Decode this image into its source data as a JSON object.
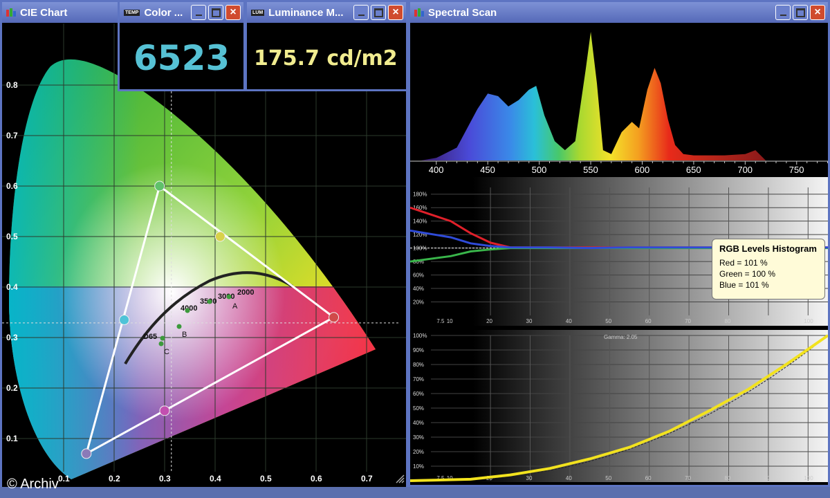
{
  "cie_window": {
    "title": "CIE Chart"
  },
  "color_window": {
    "title": "Color ...",
    "value": "6523"
  },
  "luminance_window": {
    "title": "Luminance M...",
    "value": "175.7 cd/m2"
  },
  "spectral_window": {
    "title": "Spectral Scan"
  },
  "copyright": "© Archiv",
  "icons": {
    "temp_icon": "TEMP",
    "lum_icon": "LUM"
  },
  "cie_chart": {
    "x_ticks": [
      "0.1",
      "0.2",
      "0.3",
      "0.4",
      "0.5",
      "0.6",
      "0.7"
    ],
    "y_ticks": [
      "0.1",
      "0.2",
      "0.3",
      "0.4",
      "0.5",
      "0.6",
      "0.7",
      "0.8"
    ],
    "cct_labels": [
      "2000",
      "3000",
      "3500",
      "4000",
      "D65"
    ],
    "illuminant_labels": [
      "A",
      "B",
      "C"
    ],
    "triangle_points": [
      {
        "x": 0.29,
        "y": 0.6
      },
      {
        "x": 0.635,
        "y": 0.34
      },
      {
        "x": 0.145,
        "y": 0.07
      }
    ],
    "secondary_points": [
      {
        "x": 0.41,
        "y": 0.5
      },
      {
        "x": 0.3,
        "y": 0.155
      },
      {
        "x": 0.22,
        "y": 0.335
      }
    ]
  },
  "chart_data": [
    {
      "type": "area",
      "title": "Spectral Scan",
      "x_ticks": [
        "400",
        "450",
        "500",
        "550",
        "600",
        "650",
        "700",
        "750"
      ],
      "x": [
        385,
        400,
        420,
        440,
        450,
        460,
        470,
        480,
        490,
        497,
        505,
        515,
        525,
        535,
        545,
        550,
        556,
        562,
        570,
        580,
        590,
        597,
        605,
        612,
        618,
        625,
        632,
        640,
        650,
        660,
        680,
        700,
        710,
        715,
        720
      ],
      "y": [
        0,
        0.02,
        0.1,
        0.4,
        0.52,
        0.5,
        0.42,
        0.47,
        0.55,
        0.58,
        0.35,
        0.15,
        0.08,
        0.15,
        0.7,
        1.0,
        0.6,
        0.08,
        0.05,
        0.22,
        0.3,
        0.25,
        0.55,
        0.72,
        0.6,
        0.32,
        0.12,
        0.05,
        0.04,
        0.04,
        0.04,
        0.05,
        0.08,
        0.04,
        0
      ]
    },
    {
      "type": "line",
      "title": "RGB Levels Histogram",
      "y_ticks": [
        "180%",
        "160%",
        "140%",
        "120%",
        "100%",
        "80%",
        "60%",
        "40%",
        "20%"
      ],
      "x_ticks": [
        "7.5",
        "10",
        "20",
        "30",
        "40",
        "50",
        "60",
        "70",
        "80",
        "90",
        "100"
      ],
      "x": [
        0,
        5,
        10,
        15,
        20,
        30,
        40,
        50,
        60,
        70,
        80,
        90,
        100
      ],
      "series": [
        {
          "name": "Red",
          "color": "#e0202a",
          "values": [
            160,
            140,
            122,
            108,
            101,
            101,
            101,
            101,
            101,
            101,
            101,
            101,
            101
          ]
        },
        {
          "name": "Green",
          "color": "#39b54a",
          "values": [
            80,
            88,
            95,
            98,
            100,
            100,
            100,
            100,
            100,
            100,
            100,
            100,
            100
          ]
        },
        {
          "name": "Blue",
          "color": "#2f4bd8",
          "values": [
            126,
            116,
            107,
            103,
            101,
            101,
            100,
            101,
            101,
            101,
            101,
            101,
            101
          ]
        }
      ],
      "legend": {
        "title": "RGB Levels Histogram",
        "entries": [
          "Red = 101 %",
          "Green = 100 %",
          "Blue = 101 %"
        ]
      }
    },
    {
      "type": "line",
      "title": "Gamma: 2.05",
      "y_ticks": [
        "100%",
        "90%",
        "80%",
        "70%",
        "60%",
        "50%",
        "40%",
        "30%",
        "20%",
        "10%"
      ],
      "x_ticks": [
        "7.5",
        "10",
        "20",
        "30",
        "40",
        "50",
        "60",
        "70",
        "80",
        "90",
        "100"
      ],
      "x": [
        0,
        10,
        20,
        30,
        40,
        50,
        60,
        70,
        80,
        90,
        100
      ],
      "series": [
        {
          "name": "Gamma",
          "color": "#f2e21e",
          "values": [
            0,
            1,
            4,
            8.5,
            15,
            23,
            34,
            48,
            63,
            81,
            100
          ]
        }
      ]
    }
  ]
}
